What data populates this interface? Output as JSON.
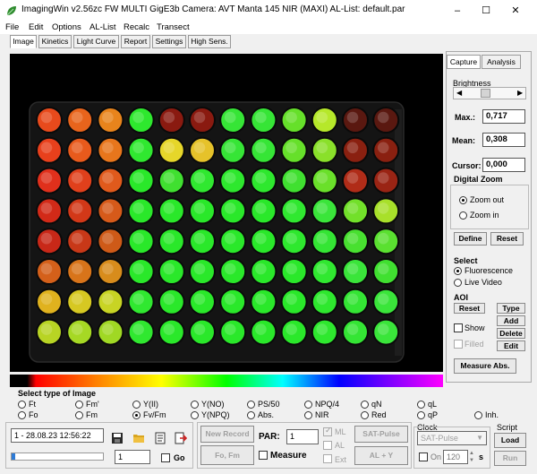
{
  "window": {
    "title": "ImagingWin v2.56zc  FW MULTI GigE3b    Camera: AVT Manta 145 NIR (MAXI)    AL-List: default.par",
    "minimize": "–",
    "maximize": "☐",
    "close": "✕"
  },
  "menu": [
    "File",
    "Edit",
    "Options",
    "AL-List",
    "Recalc",
    "Transect"
  ],
  "tabs": [
    "Image",
    "Kinetics",
    "Light Curve",
    "Report",
    "Settings",
    "High Sens."
  ],
  "right": {
    "tabs": [
      "Capture",
      "Analysis"
    ],
    "brightness_label": "Brightness",
    "max_label": "Max.:",
    "max_value": "0,717",
    "mean_label": "Mean:",
    "mean_value": "0,308",
    "cursor_label": "Cursor:",
    "cursor_value": "0,000",
    "zoom": {
      "title": "Digital Zoom",
      "zoom_out": "Zoom out",
      "zoom_in": "Zoom in",
      "define": "Define",
      "reset": "Reset"
    },
    "select": {
      "title": "Select",
      "fluorescence": "Fluorescence",
      "live_video": "Live Video"
    },
    "aoi": {
      "title": "AOI",
      "reset": "Reset",
      "type": "Type",
      "add": "Add",
      "show": "Show",
      "delete": "Delete",
      "filled": "Filled",
      "edit": "Edit"
    },
    "measure_abs": "Measure Abs."
  },
  "image_type": {
    "title": "Select type of Image",
    "options": [
      [
        "Ft",
        "Fm'",
        "Y(II)",
        "Y(NO)",
        "PS/50",
        "NPQ/4",
        "qN",
        "qL"
      ],
      [
        "Fo",
        "Fm",
        "Fv/Fm",
        "Y(NPQ)",
        "Abs.",
        "NIR",
        "Red",
        "qP",
        "Inh."
      ]
    ],
    "selected": "Fv/Fm"
  },
  "bottom": {
    "record": "1 - 28.08.23 12:56:22",
    "record_index": "1",
    "go": "Go",
    "new_record": "New Record",
    "fo_fm": "Fo, Fm",
    "par_label": "PAR:",
    "par_value": "1",
    "measure": "Measure",
    "ml": "ML",
    "al": "AL",
    "ext": "Ext",
    "sat_pulse_btn": "SAT-Pulse",
    "al_y": "AL + Y",
    "clock_title": "Clock",
    "clock_select": "SAT-Pulse",
    "on": "On",
    "clock_value": "120",
    "clock_unit": "s",
    "script_title": "Script",
    "load": "Load",
    "run": "Run"
  },
  "colors": {
    "well_grid": [
      [
        "#e84a1c",
        "#e8641c",
        "#e8841c",
        "#2ee82e",
        "#8a1a10",
        "#8a1a10",
        "#36e536",
        "#36e536",
        "#66e02a",
        "#b6e82a",
        "#5a1810",
        "#5a1810"
      ],
      [
        "#e8401c",
        "#e85a1c",
        "#e8761c",
        "#30e830",
        "#e6d62a",
        "#e6c22a",
        "#36e536",
        "#36e536",
        "#66e02a",
        "#8ae02a",
        "#8a2010",
        "#8a2010"
      ],
      [
        "#e0301c",
        "#e0401c",
        "#e05a1c",
        "#2ae82a",
        "#40e030",
        "#30e830",
        "#2ee82e",
        "#2ee82e",
        "#40e030",
        "#6ae02a",
        "#b02c18",
        "#9a2414"
      ],
      [
        "#d22a18",
        "#d23818",
        "#d65a1a",
        "#2ae82a",
        "#2ae82a",
        "#2ae82a",
        "#2ae82a",
        "#2ae82a",
        "#30e830",
        "#3ae53a",
        "#72e02a",
        "#a8e02a"
      ],
      [
        "#c82818",
        "#c83818",
        "#ce5a18",
        "#2ae82a",
        "#2ae82a",
        "#2ae82a",
        "#2ae82a",
        "#2ae82a",
        "#2ee82e",
        "#34e534",
        "#48e030",
        "#5ae030"
      ],
      [
        "#d4601a",
        "#d8741a",
        "#d88c1c",
        "#2ae82a",
        "#2ae82a",
        "#2ae82a",
        "#2ae82a",
        "#2ae82a",
        "#2ae82a",
        "#30e830",
        "#3ae53a",
        "#40e030"
      ],
      [
        "#e0b21e",
        "#d6c822",
        "#c8d424",
        "#30e830",
        "#2ae82a",
        "#2ae82a",
        "#2ae82a",
        "#2ae82a",
        "#2ae82a",
        "#2ee82e",
        "#34e534",
        "#3ae53a"
      ],
      [
        "#b8d424",
        "#a6d824",
        "#a0d824",
        "#30e830",
        "#2ae82a",
        "#2ae82a",
        "#2ae82a",
        "#2ae82a",
        "#2ae82a",
        "#2ee82e",
        "#34e534",
        "#3ae53a"
      ]
    ]
  }
}
